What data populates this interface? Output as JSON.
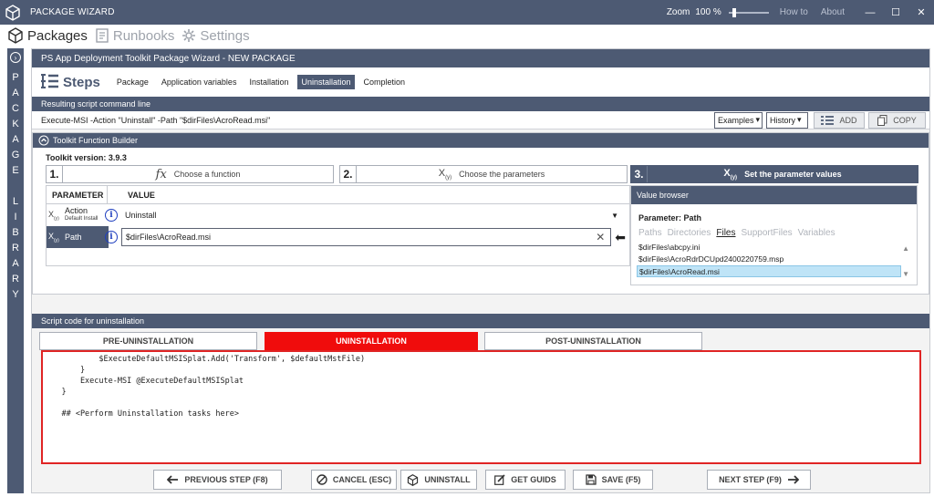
{
  "window": {
    "title": "PACKAGE WIZARD",
    "zoom_label": "Zoom",
    "zoom_value": "100 %",
    "zoom_level": 0.1,
    "how_to": "How to",
    "about": "About"
  },
  "menu": {
    "packages": "Packages",
    "runbooks": "Runbooks",
    "settings": "Settings"
  },
  "sidebar": {
    "letters": [
      "P",
      "A",
      "C",
      "K",
      "A",
      "G",
      "E",
      "",
      "L",
      "I",
      "B",
      "R",
      "A",
      "R",
      "Y"
    ]
  },
  "wizard": {
    "header": "PS App Deployment Toolkit Package Wizard  -  NEW PACKAGE",
    "steps_title": "Steps",
    "tabs": [
      {
        "label": "Package",
        "active": false
      },
      {
        "label": "Application variables",
        "active": false
      },
      {
        "label": "Installation",
        "active": false
      },
      {
        "label": "Uninstallation",
        "active": true
      },
      {
        "label": "Completion",
        "active": false
      }
    ]
  },
  "command": {
    "section_title": "Resulting script command line",
    "text": "Execute-MSI  -Action \"Uninstall\" -Path \"$dirFiles\\AcroRead.msi\"",
    "examples": "Examples",
    "history": "History",
    "add": "ADD",
    "copy": "COPY"
  },
  "builder": {
    "title": "Toolkit Function Builder",
    "version": "Toolkit version: 3.9.3",
    "step1_num": "1.",
    "step1_label": "Choose a function",
    "step2_num": "2.",
    "step2_label": "Choose the parameters",
    "step3_num": "3.",
    "step3_label": "Set the parameter values",
    "table": {
      "col_param": "PARAMETER",
      "col_value": "VALUE",
      "rows": [
        {
          "name": "Action",
          "sub1": "Default",
          "sub2": "Install",
          "value": "Uninstall"
        },
        {
          "name": "Path",
          "value": "$dirFiles\\AcroRead.msi"
        }
      ]
    },
    "value_browser": {
      "title": "Value browser",
      "param": "Parameter: Path",
      "tabs": [
        {
          "label": "Paths",
          "active": false
        },
        {
          "label": "Directories",
          "active": false
        },
        {
          "label": "Files",
          "active": true
        },
        {
          "label": "SupportFiles",
          "active": false
        },
        {
          "label": "Variables",
          "active": false
        }
      ],
      "files": [
        "$dirFiles\\abcpy.ini",
        "$dirFiles\\AcroRdrDCUpd2400220759.msp",
        "$dirFiles\\AcroRead.msi"
      ],
      "selected_index": 2
    }
  },
  "script": {
    "section_title": "Script code for uninstallation",
    "tabs": [
      {
        "label": "PRE-UNINSTALLATION",
        "active": false
      },
      {
        "label": "UNINSTALLATION",
        "active": true
      },
      {
        "label": "POST-UNINSTALLATION",
        "active": false
      }
    ],
    "code_lines": [
      "            $ExecuteDefaultMSISplat.Add('Transform', $defaultMstFile)",
      "        }",
      "        Execute-MSI @ExecuteDefaultMSISplat",
      "    }",
      "",
      "    ## <Perform Uninstallation tasks here>"
    ]
  },
  "footer": {
    "prev": "PREVIOUS STEP (F8)",
    "cancel": "CANCEL (ESC)",
    "uninstall": "UNINSTALL",
    "guids": "GET GUIDS",
    "save": "SAVE (F5)",
    "next": "NEXT STEP (F9)"
  }
}
